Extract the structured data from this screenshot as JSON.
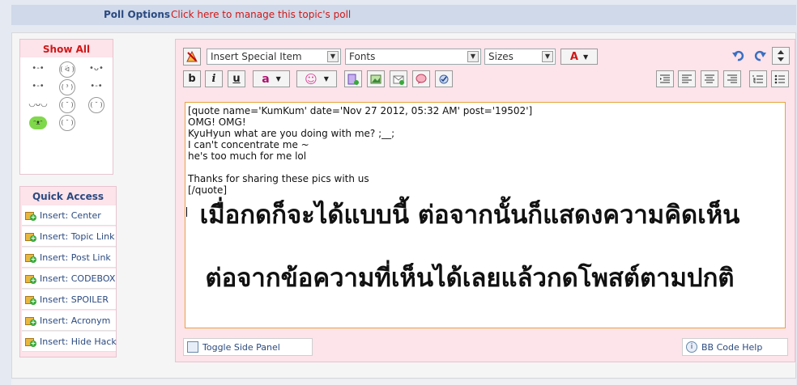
{
  "poll": {
    "label": "Poll Options",
    "link": "Click here to manage this topic's poll"
  },
  "emoticons": {
    "show_all": "Show All",
    "items": [
      "•-•",
      "( ᐛ )",
      "•ᴗ•",
      "•-•",
      "( ³ )",
      "•-•",
      "◡ᴗ◡",
      "( ˘ )",
      "( ˘ )",
      "ᵔᴥᵔ",
      "( ˘ )"
    ]
  },
  "quick_access": {
    "title": "Quick Access",
    "items": [
      "Insert: Center",
      "Insert: Topic Link",
      "Insert: Post Link",
      "Insert: CODEBOX",
      "Insert: SPOILER",
      "Insert: Acronym",
      "Insert: Hide Hack"
    ]
  },
  "toolbar": {
    "special_item": "Insert Special Item",
    "fonts": "Fonts",
    "sizes": "Sizes",
    "font_color_glyph": "A",
    "bold": "b",
    "italic": "i",
    "underline": "u",
    "color_glyph": "a",
    "emoticon_glyph": "☺"
  },
  "editor": {
    "lines": [
      "[quote name='KumKum' date='Nov 27 2012, 05:32 AM' post='19502']",
      "OMG! OMG!",
      "KyuHyun what are you doing with me? ;__;",
      "I can't concentrate me ~",
      "he's too much for me lol",
      "",
      "Thanks for sharing these pics with us",
      "[/quote]"
    ],
    "overlay_line1": "เมื่อกดก็จะได้แบบนี้ ต่อจากนั้นก็แสดงความคิดเห็น",
    "overlay_line2": "ต่อจากข้อความที่เห็นได้เลยแล้วกดโพสต์ตามปกติ"
  },
  "footer": {
    "toggle_panel": "Toggle Side Panel",
    "bbcode_help": "BB Code Help"
  },
  "colors": {
    "accent_red": "#d01818",
    "link_blue": "#2b4a80",
    "panel_pink": "#fde3ea",
    "textarea_border": "#e6a43a"
  }
}
